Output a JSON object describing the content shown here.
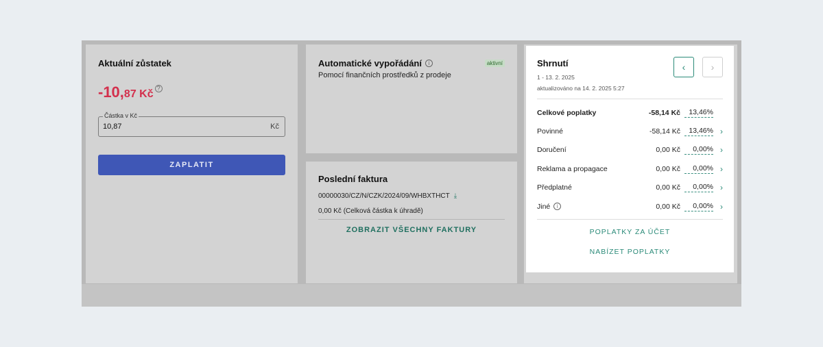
{
  "balance": {
    "title": "Aktuální zůstatek",
    "amount_int": "-10,",
    "amount_dec": "87 Kč",
    "help_glyph": "?",
    "field_legend": "Částka v Kč",
    "field_value": "10,87",
    "field_unit": "Kč",
    "pay_label": "ZAPLATIT"
  },
  "auto": {
    "title": "Automatické vypořádání",
    "info_glyph": "i",
    "badge": "aktivní",
    "subtitle": "Pomocí finančních prostředků z prodeje"
  },
  "invoice": {
    "title": "Poslední faktura",
    "number": "00000030/CZ/N/CZK/2024/09/WHBXTHCT",
    "download_glyph": "⤓",
    "amount": "0,00 Kč (Celková částka k úhradě)",
    "all_link": "ZOBRAZIT VŠECHNY FAKTURY"
  },
  "summary": {
    "title": "Shrnutí",
    "date_range": "1 - 13. 2. 2025",
    "updated": "aktualizováno na 14. 2. 2025 5:27",
    "prev_glyph": "‹",
    "next_glyph": "›",
    "fees": [
      {
        "label": "Celkové poplatky",
        "amount": "-58,14 Kč",
        "pct": "13,46%",
        "chevron": ""
      },
      {
        "label": "Povinné",
        "amount": "-58,14 Kč",
        "pct": "13,46%",
        "chevron": "›"
      },
      {
        "label": "Doručení",
        "amount": "0,00 Kč",
        "pct": "0,00%",
        "chevron": "›"
      },
      {
        "label": "Reklama a propagace",
        "amount": "0,00 Kč",
        "pct": "0,00%",
        "chevron": "›"
      },
      {
        "label": "Předplatné",
        "amount": "0,00 Kč",
        "pct": "0,00%",
        "chevron": "›"
      },
      {
        "label": "Jiné",
        "amount": "0,00 Kč",
        "pct": "0,00%",
        "chevron": "›"
      }
    ],
    "info_glyph": "i",
    "account_fees_link": "POPLATKY ZA ÚČET",
    "offer_fees_link": "NABÍZET POPLATKY"
  },
  "colors": {
    "accent_teal": "#2a8a78",
    "pay_blue": "#3f57b6",
    "negative_red": "#d32f4c"
  }
}
